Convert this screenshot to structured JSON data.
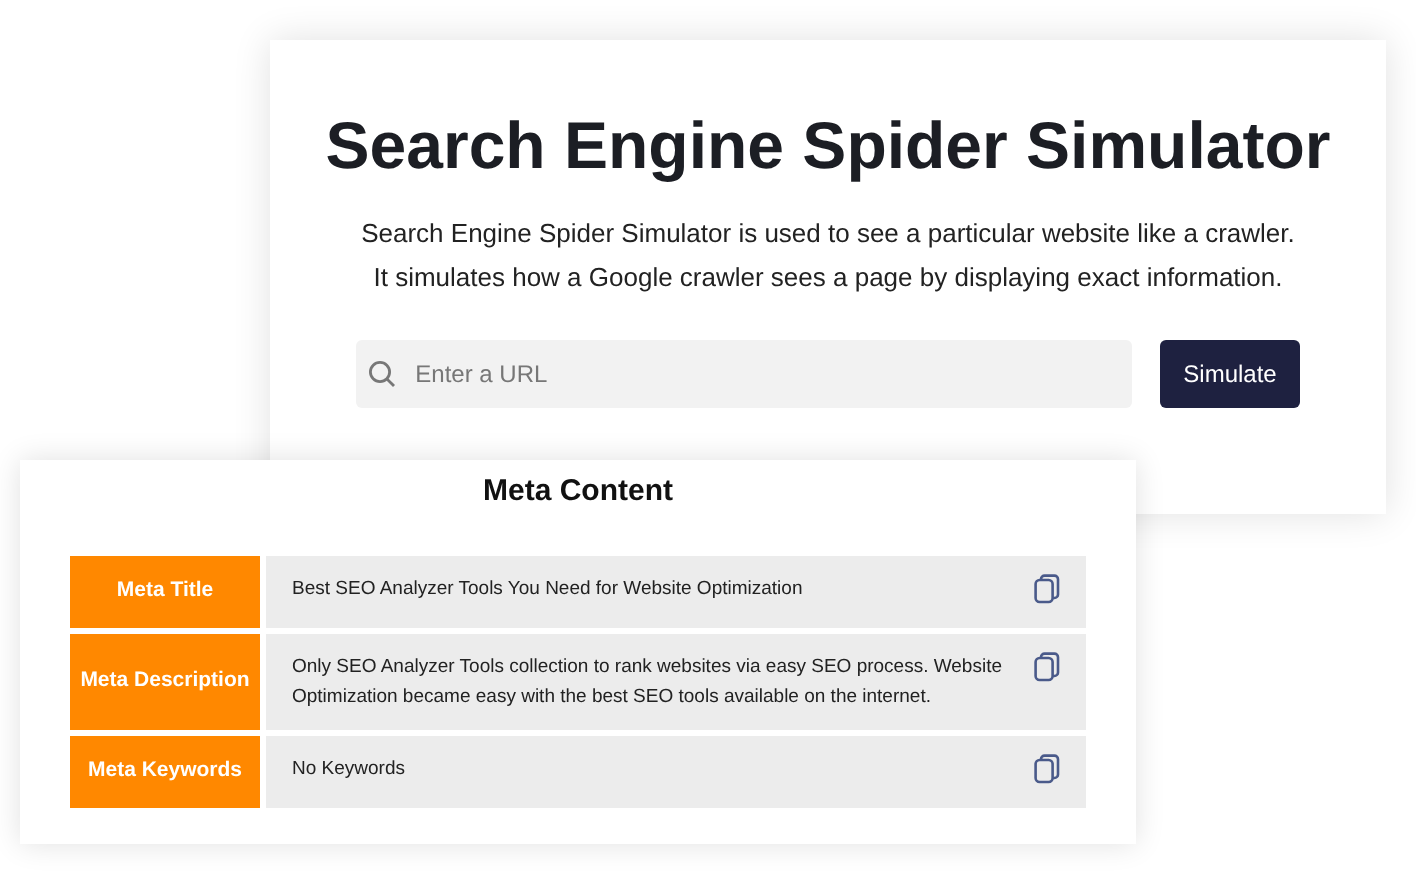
{
  "simulator": {
    "title": "Search Engine Spider Simulator",
    "description": [
      "Search Engine Spider Simulator is used to see a particular website like a crawler.",
      "It simulates how a Google crawler sees a page by displaying exact information."
    ],
    "url_field": {
      "placeholder": "Enter a URL"
    },
    "button": "Simulate"
  },
  "meta": {
    "title": "Meta Content",
    "rows": [
      {
        "label": "Meta Title",
        "value": "Best SEO Analyzer Tools You Need for Website Optimization"
      },
      {
        "label": "Meta Description",
        "value": "Only SEO Analyzer Tools collection to rank websites via easy SEO process. Website Optimization became easy with the best SEO tools available on the internet."
      },
      {
        "label": "Meta Keywords",
        "value": "No Keywords"
      }
    ]
  }
}
